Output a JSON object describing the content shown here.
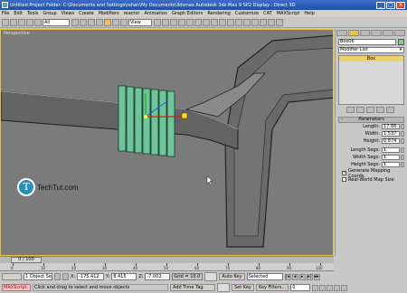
{
  "window": {
    "title": "Untitled    Project Folder: C:\\Documents and Settings\\rohan\\My Documents\\3dsmax    Autodesk 3ds Max 9 SP2    Display : Direct 3D",
    "buttons": [
      "_",
      "□",
      "×"
    ]
  },
  "menu": {
    "items": [
      "File",
      "Edit",
      "Tools",
      "Group",
      "Views",
      "Create",
      "Modifiers",
      "reactor",
      "Animation",
      "Graph Editors",
      "Rendering",
      "Customize",
      "CAT",
      "MAXScript",
      "Help"
    ]
  },
  "toolbar": {
    "selection_filter": "All",
    "ref_coord": "View"
  },
  "viewport": {
    "label": "Perspective"
  },
  "watermark": {
    "mark": "T",
    "text": "TechTut.com"
  },
  "command_panel": {
    "object_name": "Box06",
    "object_color": "#7fd18a",
    "modifier_list": "Modifier List",
    "stack_items": [
      "Box"
    ],
    "parameters": {
      "title": "Parameters",
      "length_label": "Length:",
      "length": "17.88",
      "width_label": "Width:",
      "width": "1.537",
      "height_label": "Height:",
      "height": "0.874",
      "length_segs_label": "Length Segs:",
      "length_segs": "1",
      "width_segs_label": "Width Segs:",
      "width_segs": "1",
      "height_segs_label": "Height Segs:",
      "height_segs": "1",
      "generate_mapping": "Generate Mapping Coords.",
      "generate_mapping_checked": true,
      "real_world": "Real-World Map Size",
      "real_world_checked": false
    }
  },
  "timeline": {
    "frame_display": "0 / 100",
    "ticks": [
      "0",
      "10",
      "20",
      "30",
      "40",
      "50",
      "60",
      "70",
      "80",
      "90",
      "100"
    ]
  },
  "status": {
    "selection": "1 Object Se",
    "x_label": "X:",
    "x": "-175.412",
    "y_label": "Y:",
    "y": "8.415",
    "z_label": "Z:",
    "z": "-7.002",
    "grid": "Grid = 10.0",
    "auto_key": "Auto Key",
    "selected": "Selected",
    "set_key": "Set Key",
    "key_filters": "Key Filters...",
    "frame": "0",
    "maxscript": "MAXScript",
    "prompt": "Click and drag to select and move objects",
    "add_time_tag": "Add Time Tag"
  }
}
